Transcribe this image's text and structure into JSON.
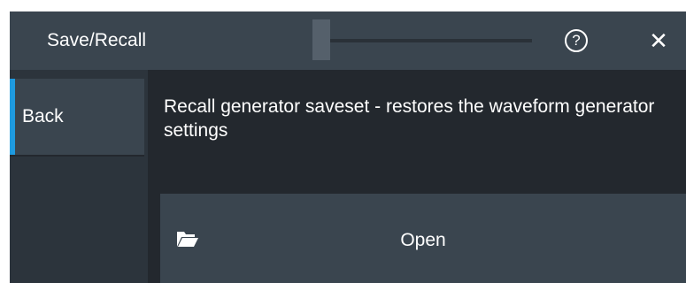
{
  "window": {
    "title": "Save/Recall",
    "help_label": "?",
    "close_label": "✕"
  },
  "sidebar": {
    "back_label": "Back"
  },
  "main": {
    "description": "Recall generator saveset - restores the waveform generator settings",
    "open_button": {
      "label": "Open",
      "icon": "folder-open-icon"
    }
  },
  "colors": {
    "titlebar": "#3a454f",
    "panel": "#23282e",
    "sidebar": "#2c343c",
    "accent": "#1f9be0",
    "text": "#ffffff"
  }
}
